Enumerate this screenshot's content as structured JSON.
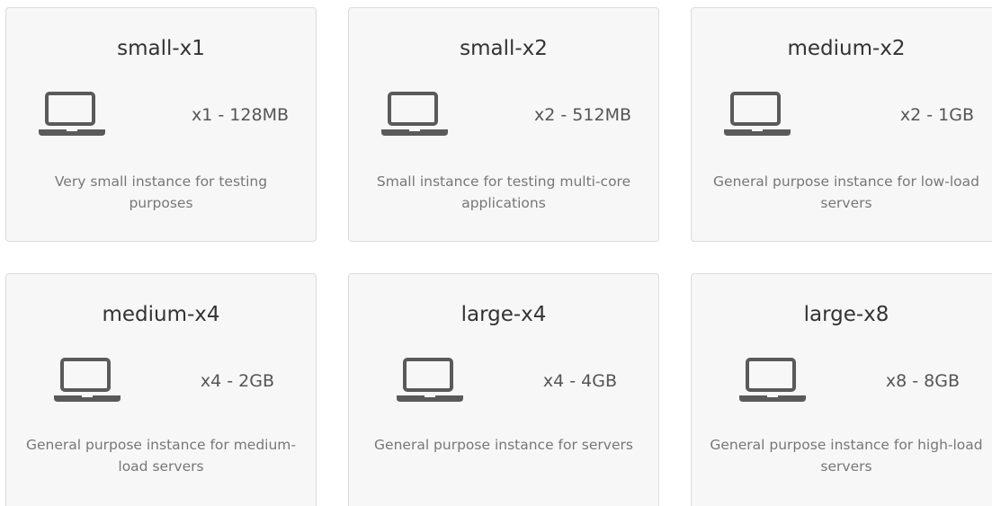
{
  "instances": [
    {
      "name": "small-x1",
      "spec": "x1 - 128MB",
      "description": "Very small instance for testing purposes",
      "icon": "laptop-icon"
    },
    {
      "name": "small-x2",
      "spec": "x2 - 512MB",
      "description": "Small instance for testing multi-core applications",
      "icon": "laptop-icon"
    },
    {
      "name": "medium-x2",
      "spec": "x2 - 1GB",
      "description": "General purpose instance for low-load servers",
      "icon": "laptop-icon"
    },
    {
      "name": "medium-x4",
      "spec": "x4 - 2GB",
      "description": "General purpose instance for medium-load servers",
      "icon": "laptop-icon"
    },
    {
      "name": "large-x4",
      "spec": "x4 - 4GB",
      "description": "General purpose instance for servers",
      "icon": "laptop-icon"
    },
    {
      "name": "large-x8",
      "spec": "x8 - 8GB",
      "description": "General purpose instance for high-load servers",
      "icon": "laptop-icon"
    }
  ],
  "colors": {
    "card_background": "#f7f7f7",
    "card_border": "#dcdcdc",
    "icon": "#5a5a5a",
    "title": "#333333",
    "text": "#555555",
    "description": "#777777"
  }
}
